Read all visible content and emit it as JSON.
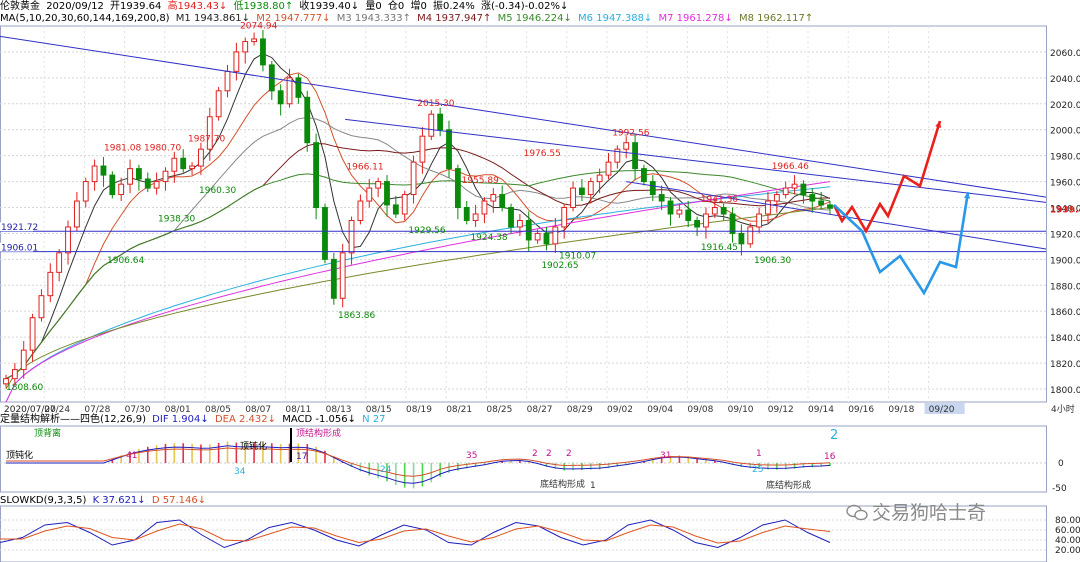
{
  "header": {
    "instrument": "伦敦黄金",
    "date": "2020/09/12",
    "open": "开1939.64",
    "high": "高1943.43↓",
    "low": "低1938.80↑",
    "close": "收1939.40↓",
    "volume": "量0",
    "position": "仓0",
    "increase": "增0",
    "amplitude": "振0.24%",
    "change": "涨(-0.34)-0.02%↓"
  },
  "ma_header": {
    "label": "MA(5,10,20,30,60,144,169,200,8)",
    "m1": "M1 1943.861↓",
    "m2": "M2 1947.777↓",
    "m3": "M3 1943.333↑",
    "m4": "M4 1937.947↑",
    "m5": "M5 1946.224↓",
    "m6": "M6 1947.388↓",
    "m7": "M7 1961.278↓",
    "m8": "M8 1962.117↑"
  },
  "macd_header": {
    "label": "定量结构解析——四色(12,26,9)",
    "dif": "DIF 1.904↓",
    "dea": "DEA 2.432↓",
    "macd": "MACD -1.056↓",
    "n": "N 27"
  },
  "kd_header": {
    "label": "SLOWKD(9,3,3,5)",
    "k": "K 37.621↓",
    "d": "D 57.146↓"
  },
  "watermark": "交易狗哈士奇",
  "colors": {
    "up": "#e0201e",
    "down": "#0a8a0a",
    "trend": "#3030c8",
    "arrow_red": "#e8211b",
    "arrow_blue": "#2a98e8",
    "price_tag": "#e0201e"
  },
  "chart_data": {
    "type": "candlestick",
    "ylim": [
      1790,
      2080
    ],
    "y_ticks": [
      "2060.00",
      "2040.00",
      "2020.00",
      "2000.00",
      "1980.00",
      "1960.00",
      "1940.00",
      "1920.00",
      "1900.00",
      "1880.00",
      "1860.00",
      "1840.00",
      "1820.00",
      "1800.00"
    ],
    "x_ticks": [
      "2020/07/20",
      "07/24",
      "07/28",
      "07/30",
      "08/01",
      "08/05",
      "08/07",
      "08/11",
      "08/13",
      "08/15",
      "08/19",
      "08/21",
      "08/25",
      "08/27",
      "08/29",
      "09/02",
      "09/04",
      "09/08",
      "09/10",
      "09/12",
      "09/14",
      "09/16",
      "09/18",
      "09/20",
      "4小时"
    ],
    "last_price": "1939.40",
    "levels": [
      {
        "label": "1921.72",
        "value": 1921.72
      },
      {
        "label": "1906.01",
        "value": 1906.01
      }
    ],
    "annotations": [
      {
        "text": "2074.94",
        "value": 2074.94,
        "kind": "high"
      },
      {
        "text": "2015.30",
        "value": 2015.3,
        "kind": "high"
      },
      {
        "text": "1981.08",
        "value": 1981.08,
        "kind": "high"
      },
      {
        "text": "1980.70",
        "value": 1980.7,
        "kind": "high"
      },
      {
        "text": "1987.70",
        "value": 1987.7,
        "kind": "high"
      },
      {
        "text": "1966.11",
        "value": 1966.11,
        "kind": "high"
      },
      {
        "text": "1955.89",
        "value": 1955.89,
        "kind": "high"
      },
      {
        "text": "1976.55",
        "value": 1976.55,
        "kind": "high"
      },
      {
        "text": "1992.56",
        "value": 1992.56,
        "kind": "high"
      },
      {
        "text": "1941.36",
        "value": 1941.36,
        "kind": "high"
      },
      {
        "text": "1966.46",
        "value": 1966.46,
        "kind": "high"
      },
      {
        "text": "1960.30",
        "value": 1960.3,
        "kind": "low"
      },
      {
        "text": "1938.30",
        "value": 1938.3,
        "kind": "low"
      },
      {
        "text": "1906.64",
        "value": 1906.64,
        "kind": "low"
      },
      {
        "text": "1929.56",
        "value": 1929.56,
        "kind": "low"
      },
      {
        "text": "1924.38",
        "value": 1924.38,
        "kind": "low"
      },
      {
        "text": "1910.07",
        "value": 1910.07,
        "kind": "low"
      },
      {
        "text": "1902.65",
        "value": 1902.65,
        "kind": "low"
      },
      {
        "text": "1916.45",
        "value": 1916.45,
        "kind": "low"
      },
      {
        "text": "1906.30",
        "value": 1906.3,
        "kind": "low"
      },
      {
        "text": "1863.86",
        "value": 1863.86,
        "kind": "low"
      },
      {
        "text": "1808.60",
        "value": 1808.6,
        "kind": "low"
      }
    ],
    "close_path": [
      1808,
      1815,
      1830,
      1855,
      1872,
      1890,
      1905,
      1925,
      1945,
      1960,
      1972,
      1965,
      1950,
      1958,
      1970,
      1962,
      1955,
      1960,
      1968,
      1978,
      1970,
      1972,
      1985,
      2010,
      2030,
      2045,
      2060,
      2068,
      2070,
      2050,
      2030,
      2020,
      2040,
      2025,
      1990,
      1940,
      1900,
      1870,
      1905,
      1930,
      1945,
      1955,
      1960,
      1942,
      1935,
      1950,
      1975,
      1995,
      2012,
      2000,
      1970,
      1940,
      1930,
      1935,
      1945,
      1950,
      1940,
      1925,
      1930,
      1915,
      1920,
      1912,
      1925,
      1940,
      1955,
      1950,
      1960,
      1965,
      1975,
      1985,
      1990,
      1970,
      1960,
      1950,
      1945,
      1935,
      1938,
      1930,
      1925,
      1935,
      1940,
      1935,
      1920,
      1912,
      1925,
      1935,
      1945,
      1950,
      1955,
      1958,
      1950,
      1945,
      1942,
      1939.4
    ],
    "trend_lines": [
      {
        "from": [
          0,
          2072
        ],
        "to": [
          1,
          1948
        ]
      },
      {
        "from": [
          0.33,
          2008
        ],
        "to": [
          1,
          1944
        ]
      }
    ],
    "macd_ticks": [
      "0",
      "-50"
    ],
    "macd_labels": [
      "顶背离",
      "顶钝化",
      "顶钝化",
      "顶结构形成",
      "底结构形成",
      "底结构形成",
      "2",
      "17",
      "41",
      "34",
      "24",
      "35",
      "2",
      "2",
      "2",
      "1",
      "31",
      "25",
      "16",
      "1"
    ],
    "kd_ticks": [
      "80.00",
      "60.00",
      "40.00",
      "20.00"
    ],
    "kd_k": [
      35,
      45,
      70,
      75,
      55,
      30,
      40,
      75,
      80,
      50,
      25,
      40,
      65,
      75,
      60,
      40,
      28,
      50,
      70,
      60,
      35,
      30,
      55,
      75,
      68,
      45,
      30,
      40,
      70,
      80,
      60,
      35,
      25,
      45,
      70,
      80,
      55,
      35
    ],
    "kd_d": [
      42,
      42,
      58,
      68,
      63,
      45,
      40,
      58,
      72,
      62,
      40,
      38,
      52,
      66,
      64,
      48,
      35,
      42,
      58,
      62,
      48,
      36,
      45,
      62,
      68,
      56,
      40,
      38,
      55,
      70,
      66,
      48,
      34,
      38,
      55,
      68,
      62,
      57
    ]
  }
}
